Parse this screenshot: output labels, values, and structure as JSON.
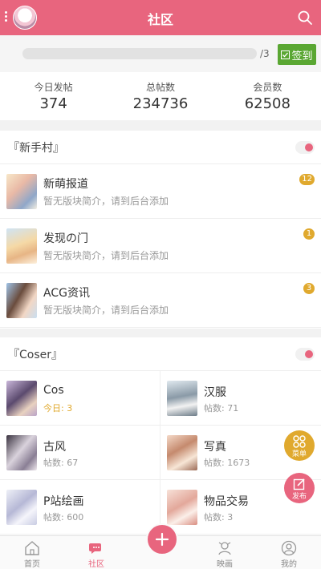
{
  "header": {
    "title": "社区"
  },
  "sign": {
    "progress": 0,
    "days_label": "/3",
    "button_label": "签到"
  },
  "stats": [
    {
      "label": "今日发帖",
      "value": "374"
    },
    {
      "label": "总帖数",
      "value": "234736"
    },
    {
      "label": "会员数",
      "value": "62508"
    }
  ],
  "sections": [
    {
      "name": "『新手村』",
      "forums": [
        {
          "name": "新萌报道",
          "desc": "暂无版块简介，请到后台添加",
          "badge": "12"
        },
        {
          "name": "发现の门",
          "desc": "暂无版块简介，请到后台添加",
          "badge": "1"
        },
        {
          "name": "ACG资讯",
          "desc": "暂无版块简介，请到后台添加",
          "badge": "3"
        }
      ]
    },
    {
      "name": "『Coser』",
      "cells": [
        {
          "name": "Cos",
          "info": "今日: 3"
        },
        {
          "name": "汉服",
          "info": "帖数: 71"
        },
        {
          "name": "古风",
          "info": "帖数: 67"
        },
        {
          "name": "写真",
          "info": "帖数: 1673"
        },
        {
          "name": "P站绘画",
          "info": "帖数: 600"
        },
        {
          "name": "物品交易",
          "info": "帖数: 3"
        }
      ]
    }
  ],
  "fabs": {
    "menu_label": "菜单",
    "post_label": "发布"
  },
  "tabbar": [
    {
      "label": "首页",
      "icon": "home-icon"
    },
    {
      "label": "社区",
      "icon": "community-icon"
    },
    {
      "label": "",
      "icon": "plus-icon"
    },
    {
      "label": "映画",
      "icon": "video-icon"
    },
    {
      "label": "我的",
      "icon": "user-icon"
    }
  ],
  "colors": {
    "primary": "#e8657e",
    "badge": "#e0a92e",
    "sign_button": "#5aa733"
  }
}
